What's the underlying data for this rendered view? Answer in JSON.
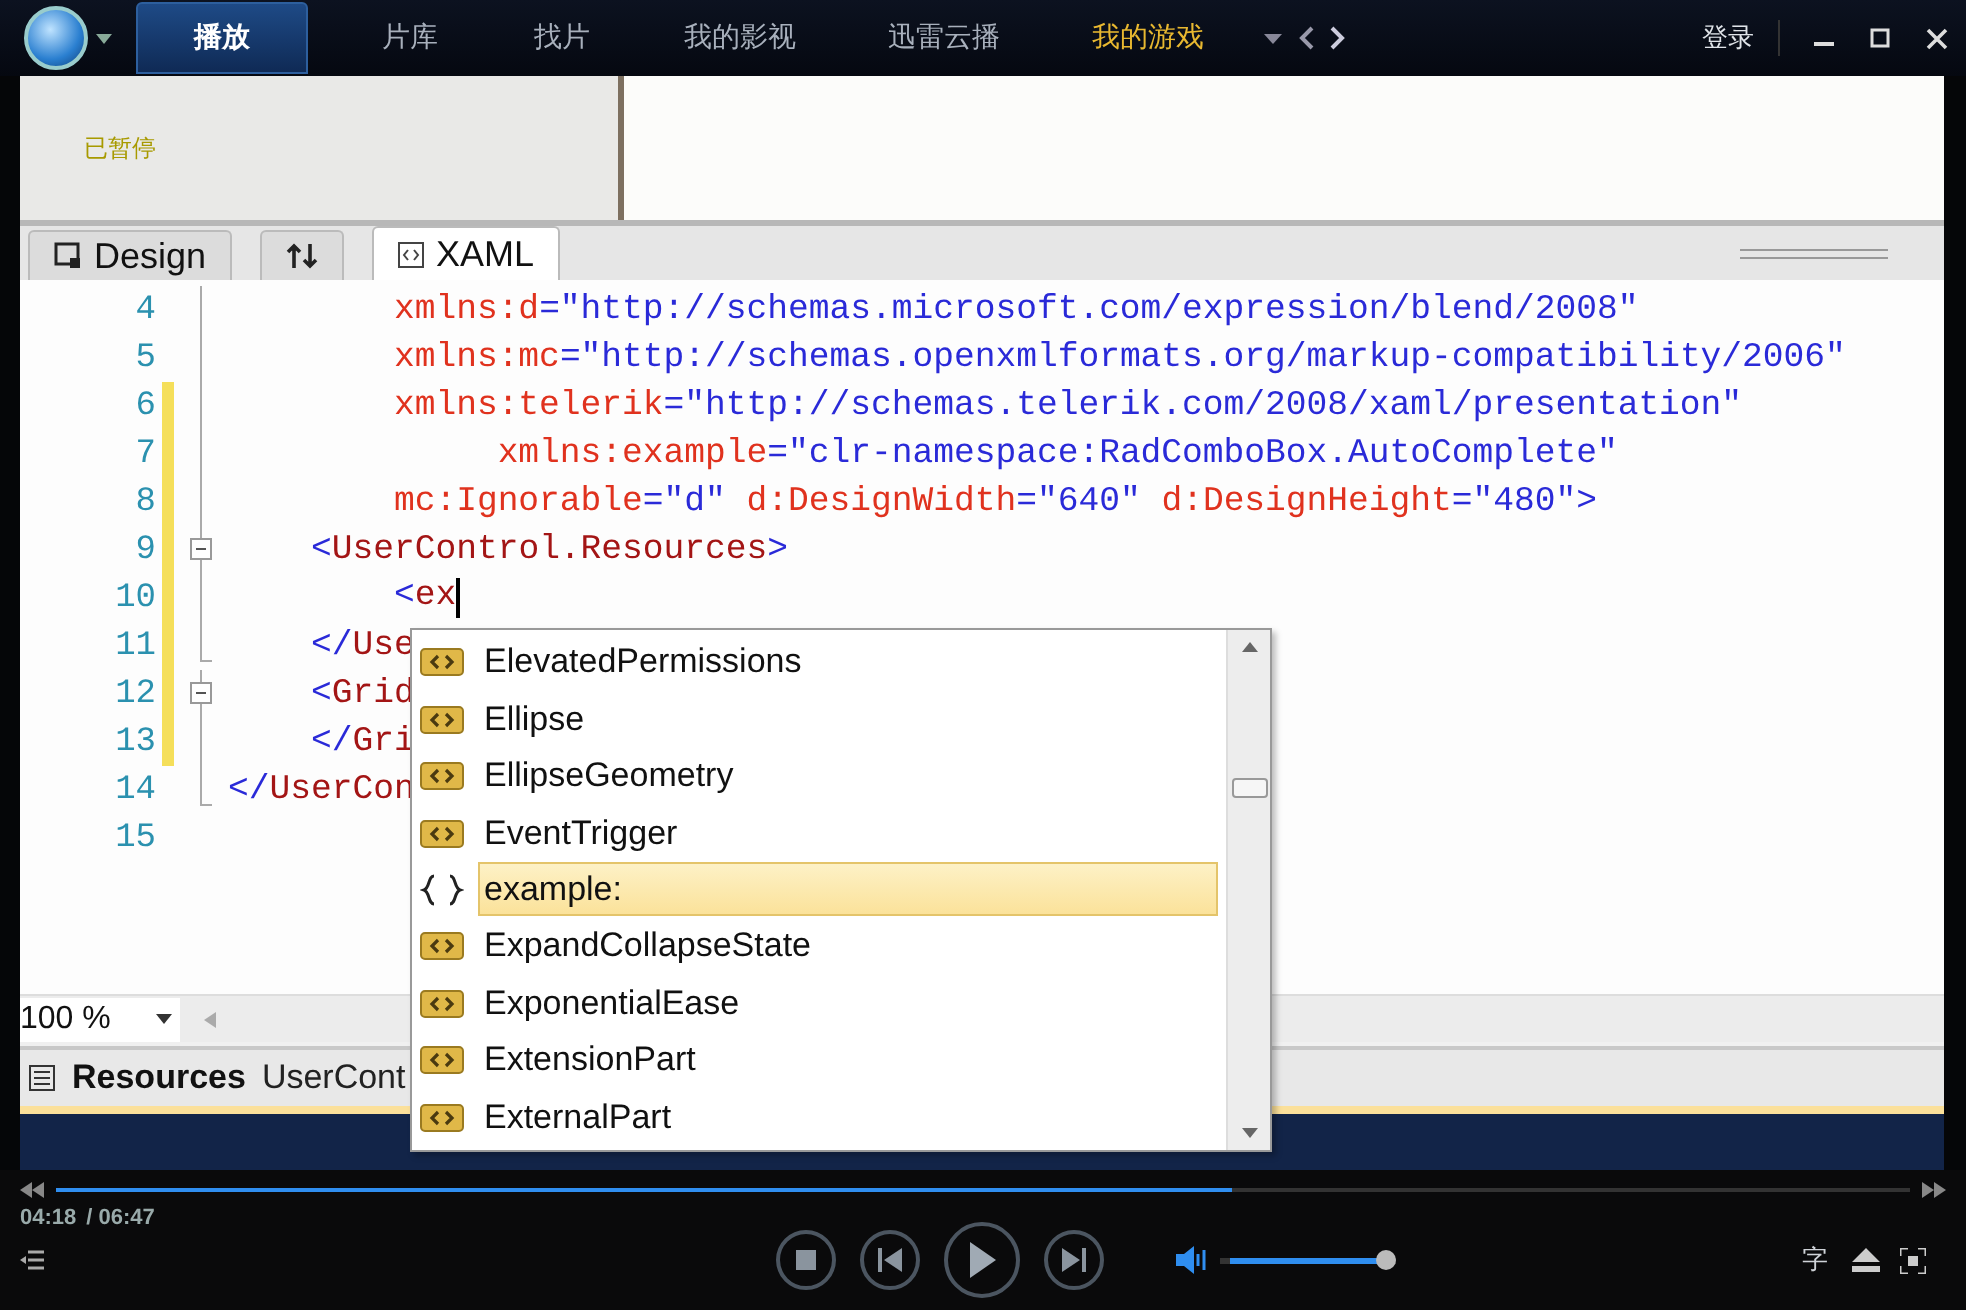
{
  "top_bar": {
    "tabs": [
      {
        "label": "播放",
        "selected": true,
        "highlighted": false
      },
      {
        "label": "片库",
        "selected": false,
        "highlighted": false
      },
      {
        "label": "找片",
        "selected": false,
        "highlighted": false
      },
      {
        "label": "我的影视",
        "selected": false,
        "highlighted": false
      },
      {
        "label": "迅雷云播",
        "selected": false,
        "highlighted": false
      },
      {
        "label": "我的游戏",
        "selected": false,
        "highlighted": true
      }
    ],
    "login": "登录"
  },
  "video": {
    "status": "已暂停",
    "editor": {
      "tabs": [
        {
          "label": "Design",
          "kind": "design",
          "selected": false
        },
        {
          "kind": "swap",
          "selected": false
        },
        {
          "label": "XAML",
          "kind": "xaml",
          "selected": true
        }
      ],
      "lines": [
        {
          "number": "4",
          "changed": false,
          "kind": "body",
          "cursor": false,
          "tokens": [
            {
              "kind": "attr",
              "text": "        xmlns:d"
            },
            {
              "kind": "value",
              "text": "=\"http://schemas.microsoft.com/expression/blend/2008\""
            }
          ]
        },
        {
          "number": "5",
          "changed": false,
          "kind": "body",
          "cursor": false,
          "tokens": [
            {
              "kind": "attr",
              "text": "        xmlns:mc"
            },
            {
              "kind": "value",
              "text": "=\"http://schemas.openxmlformats.org/markup-compatibility/2006\""
            }
          ]
        },
        {
          "number": "6",
          "changed": true,
          "kind": "body",
          "cursor": false,
          "tokens": [
            {
              "kind": "attr",
              "text": "        xmlns:telerik"
            },
            {
              "kind": "value",
              "text": "=\"http://schemas.telerik.com/2008/xaml/presentation\""
            }
          ]
        },
        {
          "number": "7",
          "changed": true,
          "kind": "body",
          "cursor": false,
          "tokens": [
            {
              "kind": "attr",
              "text": "             xmlns:example"
            },
            {
              "kind": "value",
              "text": "=\"clr-namespace:RadComboBox.AutoComplete\""
            }
          ]
        },
        {
          "number": "8",
          "changed": true,
          "kind": "body",
          "cursor": false,
          "tokens": [
            {
              "kind": "attr",
              "text": "        mc:Ignorable"
            },
            {
              "kind": "value",
              "text": "=\"d\" "
            },
            {
              "kind": "attr",
              "text": "d:DesignWidth"
            },
            {
              "kind": "value",
              "text": "=\"640\" "
            },
            {
              "kind": "attr",
              "text": "d:DesignHeight"
            },
            {
              "kind": "value",
              "text": "=\"480\">"
            }
          ]
        },
        {
          "number": "9",
          "changed": true,
          "kind": "fold",
          "cursor": false,
          "tokens": [
            {
              "kind": "value",
              "text": "    <"
            },
            {
              "kind": "tag",
              "text": "UserControl.Resources"
            },
            {
              "kind": "value",
              "text": ">"
            }
          ]
        },
        {
          "number": "10",
          "changed": true,
          "kind": "body",
          "cursor": true,
          "tokens": [
            {
              "kind": "value",
              "text": "        <"
            },
            {
              "kind": "tag",
              "text": "ex"
            }
          ]
        },
        {
          "number": "11",
          "changed": true,
          "kind": "end",
          "cursor": false,
          "tokens": [
            {
              "kind": "value",
              "text": "    </"
            },
            {
              "kind": "tag",
              "text": "Use"
            }
          ]
        },
        {
          "number": "12",
          "changed": true,
          "kind": "fold",
          "cursor": false,
          "tokens": [
            {
              "kind": "value",
              "text": "    <"
            },
            {
              "kind": "tag",
              "text": "Grid"
            }
          ]
        },
        {
          "number": "13",
          "changed": true,
          "kind": "body",
          "cursor": false,
          "tokens": [
            {
              "kind": "value",
              "text": "    </"
            },
            {
              "kind": "tag",
              "text": "Gri"
            }
          ]
        },
        {
          "number": "14",
          "changed": false,
          "kind": "end",
          "cursor": false,
          "tokens": [
            {
              "kind": "value",
              "text": "</"
            },
            {
              "kind": "tag",
              "text": "UserCon"
            }
          ]
        },
        {
          "number": "15",
          "changed": false,
          "kind": "blank",
          "cursor": false
        }
      ],
      "completion": [
        {
          "label": "ElevatedPermissions",
          "kind": "element",
          "selected": false
        },
        {
          "label": "Ellipse",
          "kind": "element",
          "selected": false
        },
        {
          "label": "EllipseGeometry",
          "kind": "element",
          "selected": false
        },
        {
          "label": "EventTrigger",
          "kind": "element",
          "selected": false
        },
        {
          "label": "example:",
          "kind": "namespace",
          "selected": true
        },
        {
          "label": "ExpandCollapseState",
          "kind": "element",
          "selected": false
        },
        {
          "label": "ExponentialEase",
          "kind": "element",
          "selected": false
        },
        {
          "label": "ExtensionPart",
          "kind": "element",
          "selected": false
        },
        {
          "label": "ExternalPart",
          "kind": "element",
          "selected": false
        }
      ],
      "zoom": "100 %",
      "breadcrumb": {
        "title": "Resources",
        "path": "UserCont"
      }
    }
  },
  "controls": {
    "progress": {
      "level": 0.634
    },
    "current_time": "04:18",
    "total_time": "/ 06:47",
    "volume": {
      "level": 1.0
    },
    "subtitle": "字"
  }
}
